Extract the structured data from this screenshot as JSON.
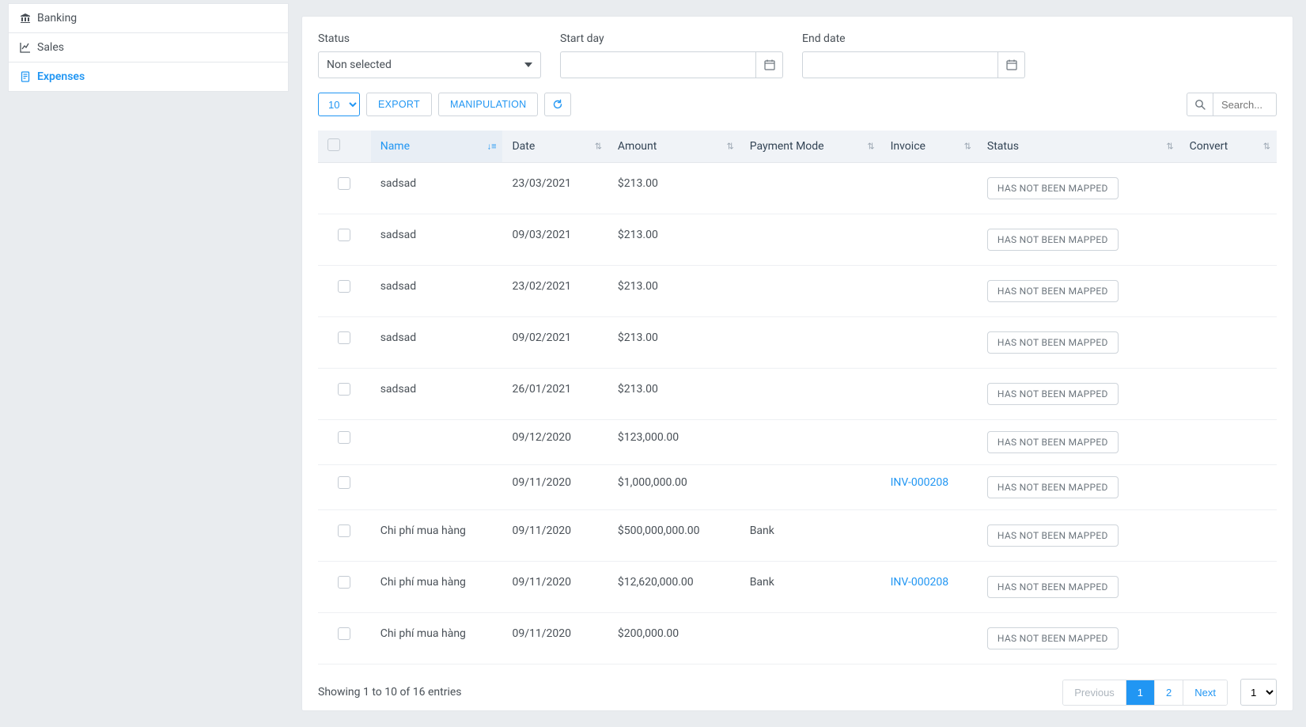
{
  "sidebar": {
    "items": [
      {
        "label": "Banking",
        "icon": "bank-icon"
      },
      {
        "label": "Sales",
        "icon": "chart-line-icon"
      },
      {
        "label": "Expenses",
        "icon": "file-invoice-icon"
      }
    ],
    "active_index": 2
  },
  "filters": {
    "status_label": "Status",
    "status_value": "Non selected",
    "start_label": "Start day",
    "start_value": "",
    "end_label": "End date",
    "end_value": ""
  },
  "toolbar": {
    "page_size": "10",
    "export": "EXPORT",
    "manipulation": "MANIPULATION",
    "search_placeholder": "Search..."
  },
  "table": {
    "columns": {
      "name": "Name",
      "date": "Date",
      "amount": "Amount",
      "payment_mode": "Payment Mode",
      "invoice": "Invoice",
      "status": "Status",
      "convert": "Convert"
    },
    "status_badge": "HAS NOT BEEN MAPPED",
    "rows": [
      {
        "name": "sadsad",
        "date": "23/03/2021",
        "amount": "$213.00",
        "payment_mode": "",
        "invoice": "",
        "pad": true
      },
      {
        "name": "sadsad",
        "date": "09/03/2021",
        "amount": "$213.00",
        "payment_mode": "",
        "invoice": "",
        "pad": true
      },
      {
        "name": "sadsad",
        "date": "23/02/2021",
        "amount": "$213.00",
        "payment_mode": "",
        "invoice": "",
        "pad": true
      },
      {
        "name": "sadsad",
        "date": "09/02/2021",
        "amount": "$213.00",
        "payment_mode": "",
        "invoice": "",
        "pad": true
      },
      {
        "name": "sadsad",
        "date": "26/01/2021",
        "amount": "$213.00",
        "payment_mode": "",
        "invoice": "",
        "pad": true
      },
      {
        "name": "",
        "date": "09/12/2020",
        "amount": "$123,000.00",
        "payment_mode": "",
        "invoice": "",
        "pad": false
      },
      {
        "name": "",
        "date": "09/11/2020",
        "amount": "$1,000,000.00",
        "payment_mode": "",
        "invoice": "INV-000208",
        "pad": false
      },
      {
        "name": "Chi phí mua hàng",
        "date": "09/11/2020",
        "amount": "$500,000,000.00",
        "payment_mode": "Bank",
        "invoice": "",
        "pad": true
      },
      {
        "name": "Chi phí mua hàng",
        "date": "09/11/2020",
        "amount": "$12,620,000.00",
        "payment_mode": "Bank",
        "invoice": "INV-000208",
        "pad": true
      },
      {
        "name": "Chi phí mua hàng",
        "date": "09/11/2020",
        "amount": "$200,000.00",
        "payment_mode": "",
        "invoice": "",
        "pad": true
      }
    ]
  },
  "footer": {
    "info": "Showing 1 to 10 of 16 entries",
    "previous": "Previous",
    "next": "Next",
    "pages": [
      "1",
      "2"
    ],
    "active_page": 0,
    "jump": "1"
  }
}
